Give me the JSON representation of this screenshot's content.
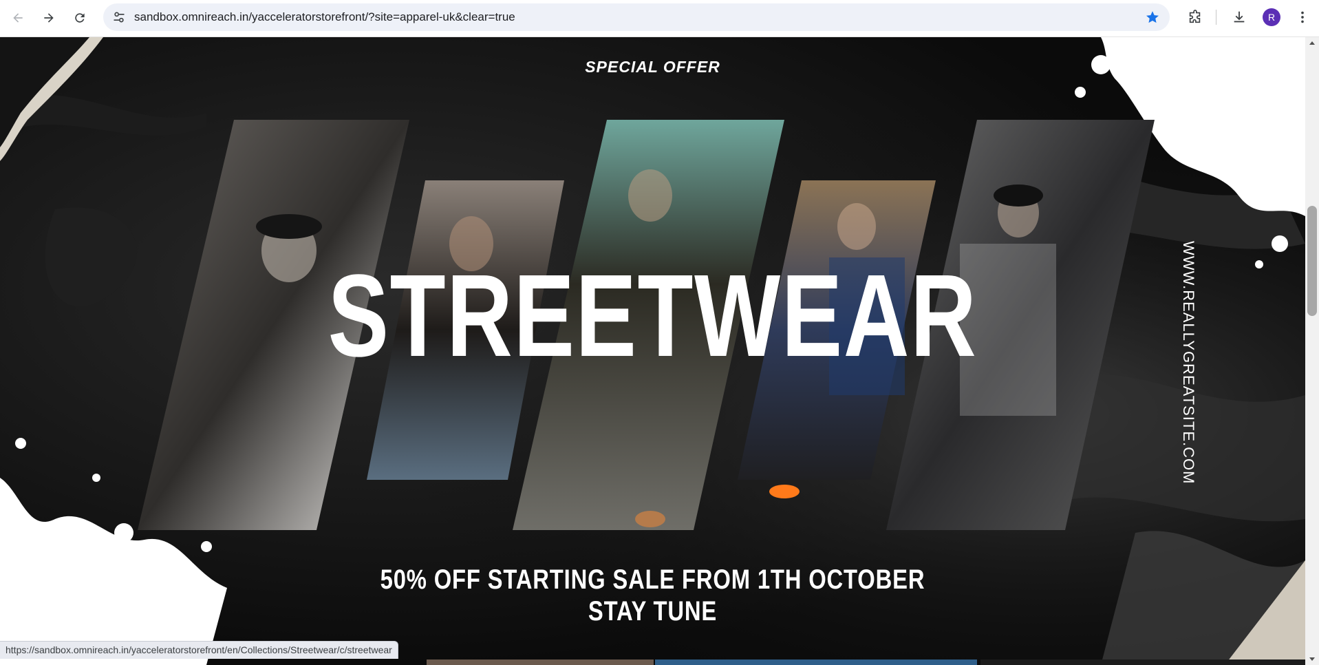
{
  "browser": {
    "url": "sandbox.omnireach.in/yacceleratorstorefront/?site=apparel-uk&clear=true",
    "profile_initial": "R",
    "icons": {
      "back": "arrow-left-icon",
      "forward": "arrow-right-icon",
      "reload": "reload-icon",
      "site_info": "tune-icon",
      "bookmark": "star-filled-icon",
      "extensions": "puzzle-icon",
      "downloads": "download-icon",
      "menu": "kebab-menu-icon"
    },
    "accent_color": "#1a73e8"
  },
  "banner": {
    "kicker": "SPECIAL OFFER",
    "headline": "STREETWEAR",
    "site": "WWW.REALLYGREATSITE.COM",
    "sale_line_1": "50% OFF STARTING SALE FROM 1TH OCTOBER",
    "sale_line_2": "STAY TUNE",
    "photo_panels": [
      {
        "name": "photo-woman-black-cap"
      },
      {
        "name": "photo-woman-black-tshirt"
      },
      {
        "name": "photo-man-sitting-steps"
      },
      {
        "name": "photo-woman-blue-jacket"
      },
      {
        "name": "photo-man-denim-jacket"
      }
    ]
  },
  "status_bar": {
    "link": "https://sandbox.omnireach.in/yacceleratorstorefront/en/Collections/Streetwear/c/streetwear"
  }
}
